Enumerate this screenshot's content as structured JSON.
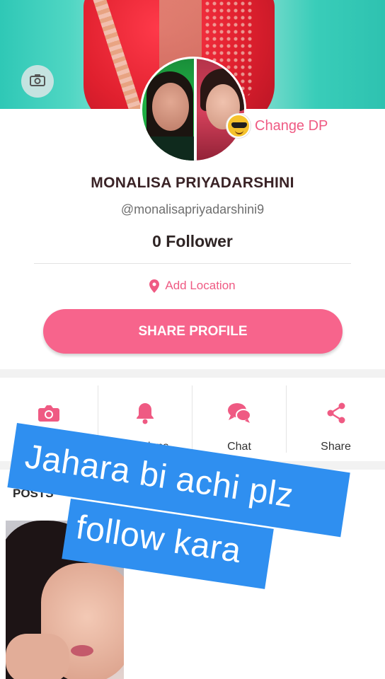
{
  "profile": {
    "change_dp_label": "Change DP",
    "name": "MONALISA PRIYADARSHINI",
    "handle": "@monalisapriyadarshini9",
    "followers": "0 Follower",
    "location_label": "Add Location",
    "share_button": "SHARE PROFILE"
  },
  "actions": [
    {
      "label": "",
      "icon": "camera-icon"
    },
    {
      "label": "tifications",
      "icon": "bell-icon"
    },
    {
      "label": "Chat",
      "icon": "chat-icon"
    },
    {
      "label": "Share",
      "icon": "share-icon"
    }
  ],
  "posts": {
    "label": "POSTS"
  },
  "overlay": {
    "line1": "Jahara bi achi plz",
    "line2": "follow kara"
  },
  "colors": {
    "accent": "#f7648c",
    "pink_text": "#ef5a83",
    "sticker_blue": "#2f8ff0"
  }
}
